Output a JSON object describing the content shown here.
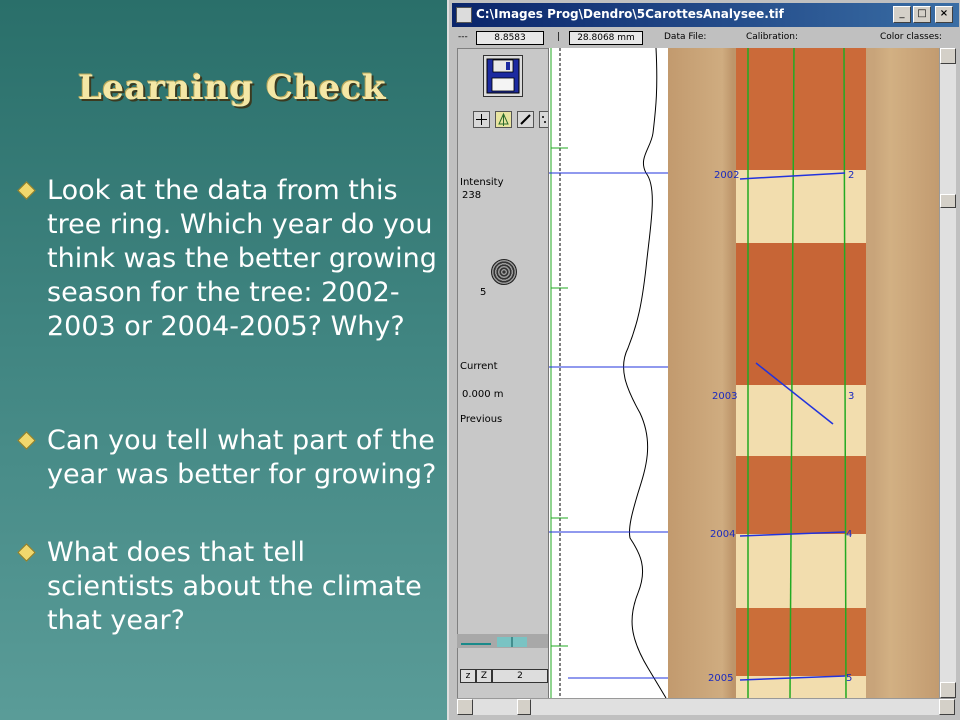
{
  "slide": {
    "title": "Learning Check",
    "bullets": [
      "Look at the data from this tree ring. Which year do you think was the better growing season for the tree: 2002-2003 or 2004-2005? Why?",
      "Can you tell what part of the year was better for growing?",
      "What does that tell scientists about the climate that year?"
    ]
  },
  "window": {
    "title": "C:\\Images Prog\\Dendro\\5CarottesAnalysee.tif",
    "buttons": {
      "minimize": "_",
      "maximize": "□",
      "close": "×"
    },
    "infobar": {
      "lead": "---",
      "value1": "8.8583",
      "separator": "|",
      "value2": "28.8068 mm",
      "data_file_label": "Data File:",
      "calibration_label": "Calibration:",
      "color_classes_label": "Color classes:"
    }
  },
  "tool_panel": {
    "intensity_label": "Intensity",
    "intensity_value": "238",
    "ring_count": "5",
    "current_label": "Current",
    "current_value": "0.000 m",
    "previous_label": "Previous",
    "bottom": {
      "z1": "z",
      "z2": "Z",
      "value": "2"
    }
  },
  "rings": [
    {
      "year": "2002",
      "index": "2"
    },
    {
      "year": "2003",
      "index": "3"
    },
    {
      "year": "2004",
      "index": "4"
    },
    {
      "year": "2005",
      "index": "5"
    }
  ],
  "colors": {
    "slide_bg_top": "#2a6f6a",
    "slide_bg_bottom": "#5a9c98",
    "title": "#f4e7a6",
    "bullet_marker": "#f1d86d",
    "titlebar": "#0a246a",
    "measure_line": "#2233dd",
    "ring_boundary": "#22aa22",
    "latewood": "#c8602f",
    "earlywood": "#f6e2b0"
  }
}
